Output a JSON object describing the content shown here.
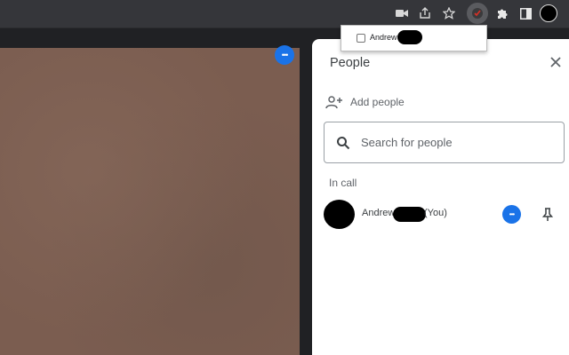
{
  "toolbar": {
    "icons": [
      "camera-icon",
      "share-icon",
      "star-icon",
      "extension-active-icon",
      "puzzle-icon",
      "sidebar-icon",
      "profile-avatar"
    ]
  },
  "popup": {
    "checkbox_label": "Andrew",
    "checked": false
  },
  "video": {
    "more_options_glyph": "•••"
  },
  "people_panel": {
    "title": "People",
    "close_glyph": "✕",
    "add_people_label": "Add people",
    "search_placeholder": "Search for people",
    "section_in_call": "In call",
    "participants": [
      {
        "name": "Andrew",
        "suffix": "(You)"
      }
    ]
  },
  "colors": {
    "toolbar_bg": "#35363a",
    "page_bg": "#202124",
    "accent_blue": "#1a73e8",
    "video_tint": "#7b5d50"
  }
}
